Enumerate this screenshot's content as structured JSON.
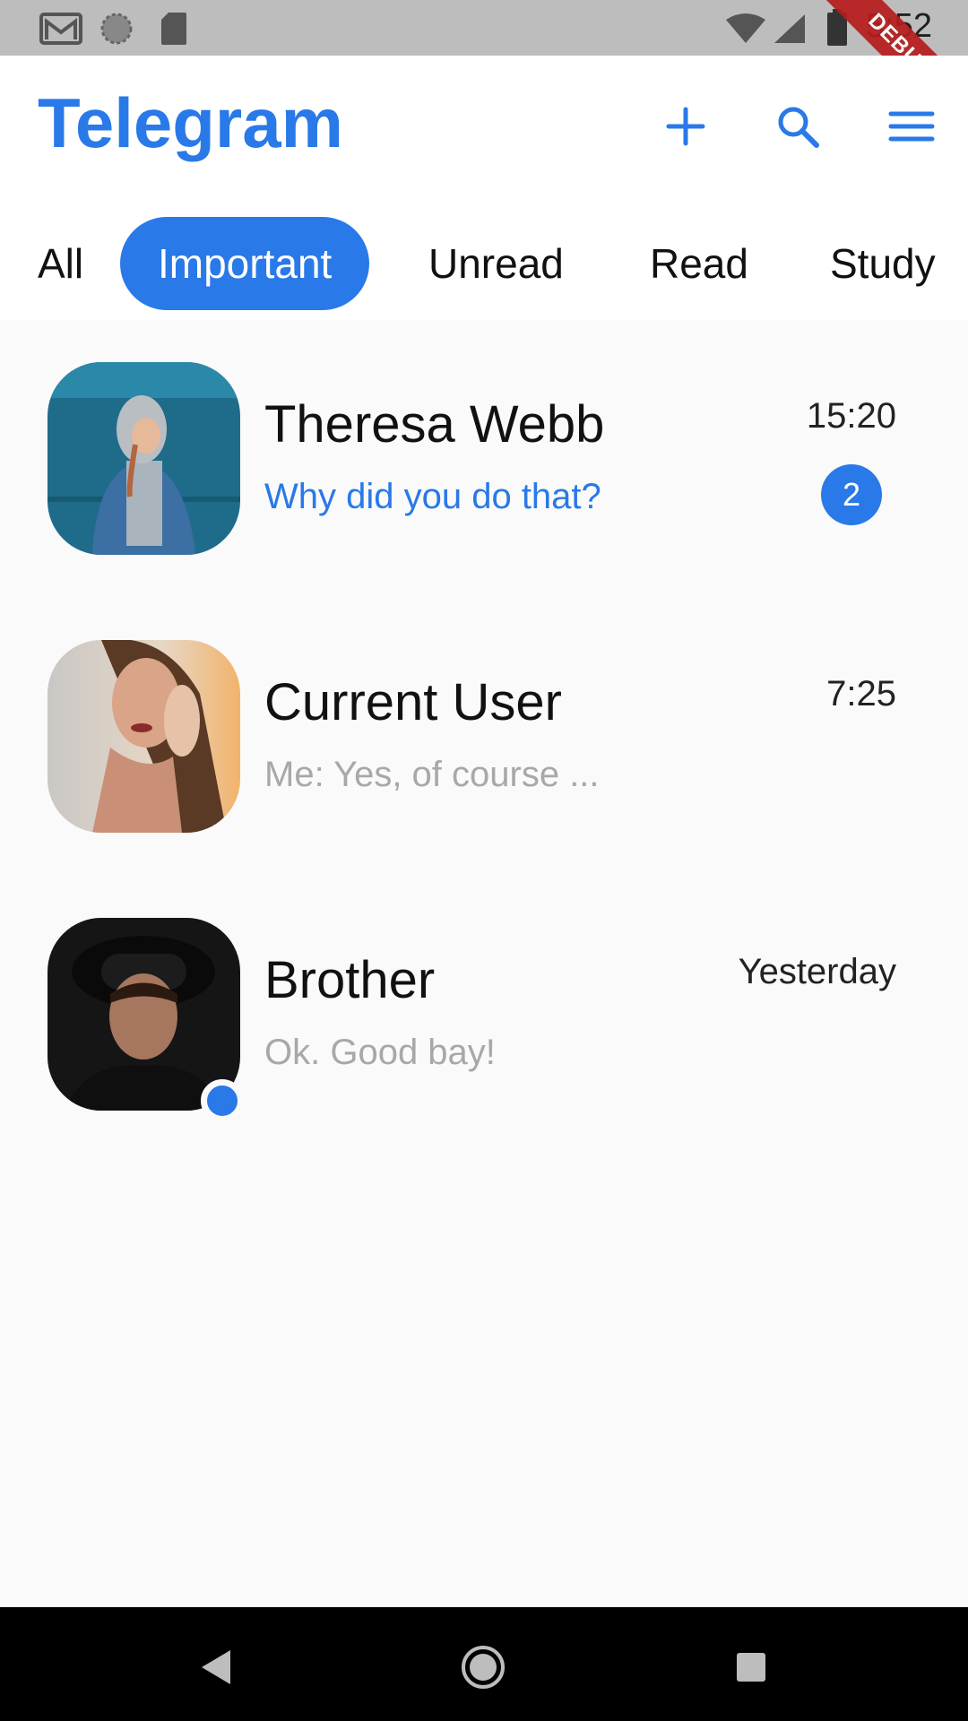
{
  "status_bar": {
    "time": "5:52",
    "icons": [
      "gmail-icon",
      "sync-icon",
      "sd-card-icon",
      "wifi-icon",
      "signal-icon",
      "battery-icon"
    ],
    "debug_label": "DEBUG"
  },
  "app_bar": {
    "title": "Telegram",
    "actions": [
      "add-icon",
      "search-icon",
      "menu-icon"
    ]
  },
  "tabs": [
    {
      "label": "All",
      "active": false
    },
    {
      "label": "Important",
      "active": true
    },
    {
      "label": "Unread",
      "active": false
    },
    {
      "label": "Read",
      "active": false
    },
    {
      "label": "Study",
      "active": false
    }
  ],
  "chats": [
    {
      "name": "Theresa Webb",
      "message": "Why did you do that?",
      "time": "15:20",
      "unread_count": "2",
      "online": false
    },
    {
      "name": "Current User",
      "message": "Me: Yes, of course ...",
      "time": "7:25",
      "unread_count": "",
      "online": false
    },
    {
      "name": "Brother",
      "message": "Ok. Good bay!",
      "time": "Yesterday",
      "unread_count": "",
      "online": true
    }
  ],
  "colors": {
    "accent": "#2979e8",
    "status_bar": "#bdbdbd",
    "background": "#fafafa",
    "muted_text": "#a8a8a8"
  },
  "nav_bar": {
    "buttons": [
      "back-icon",
      "home-icon",
      "recents-icon"
    ]
  }
}
